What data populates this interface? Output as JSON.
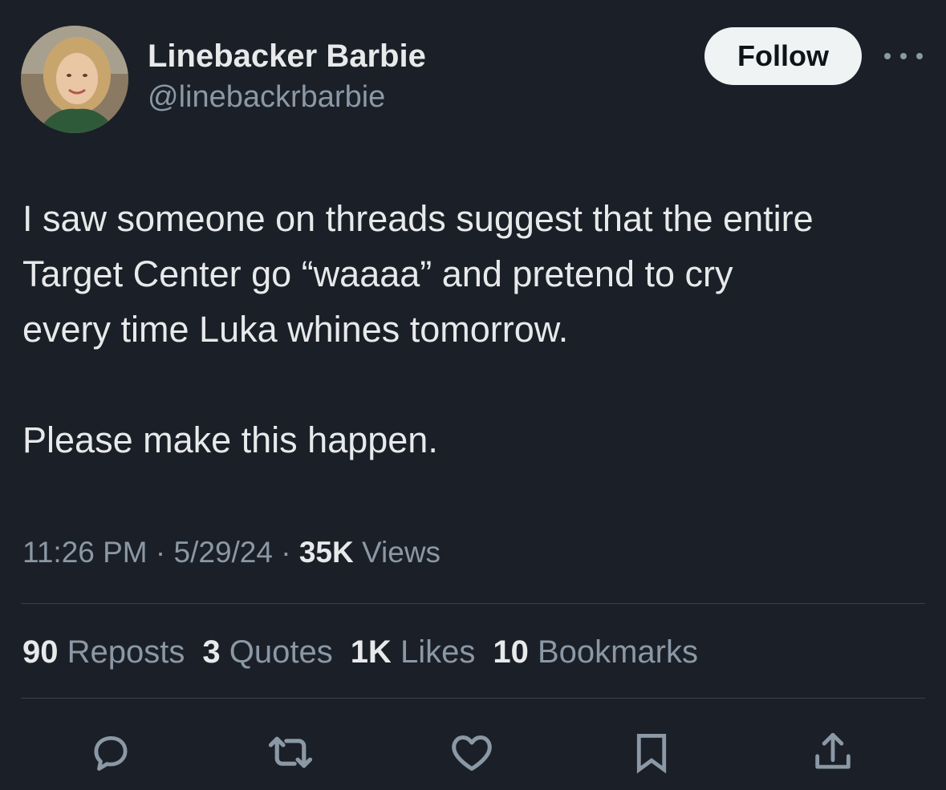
{
  "author": {
    "display_name": "Linebacker Barbie",
    "handle": "@linebackrbarbie"
  },
  "header": {
    "follow_label": "Follow"
  },
  "tweet": {
    "lines": [
      "I saw someone on threads suggest that the entire",
      "Target Center go “waaaa” and pretend to cry",
      "every time Luka whines tomorrow.",
      "Please make this happen."
    ]
  },
  "meta": {
    "time": "11:26 PM",
    "separator1": " · ",
    "date": "5/29/24",
    "separator2": " · ",
    "views_count": "35K",
    "views_label": " Views"
  },
  "stats": {
    "reposts_count": "90",
    "reposts_label": " Reposts",
    "quotes_count": "3",
    "quotes_label": " Quotes",
    "likes_count": "1K",
    "likes_label": " Likes",
    "bookmarks_count": "10",
    "bookmarks_label": " Bookmarks"
  },
  "icons": {
    "reply": "reply-icon",
    "repost": "repost-icon",
    "like": "heart-icon",
    "bookmark": "bookmark-icon",
    "share": "share-icon",
    "more": "more-icon"
  },
  "colors": {
    "background": "#1b1f27",
    "primary_text": "#e7e9ea",
    "secondary_text": "#8b98a5",
    "follow_button_bg": "#eff3f4",
    "divider": "#38414b"
  }
}
